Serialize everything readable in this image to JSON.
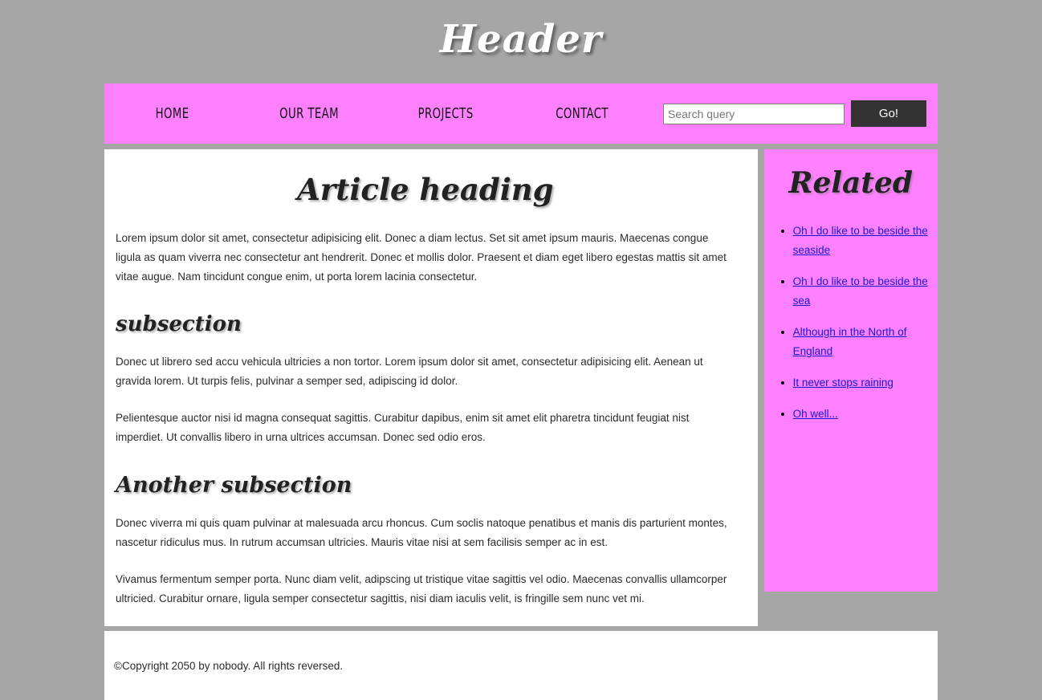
{
  "site": {
    "title": "Header",
    "background_color": "#a6a6a6",
    "accent_color": "#ff80ff",
    "button_color": "#333333",
    "link_color": "#1b1bcc"
  },
  "nav": {
    "items": [
      {
        "label": "HOME"
      },
      {
        "label": "OUR TEAM"
      },
      {
        "label": "PROJECTS"
      },
      {
        "label": "CONTACT"
      }
    ],
    "search": {
      "placeholder": "Search query",
      "value": "",
      "button_label": "Go!"
    }
  },
  "article": {
    "title": "Article heading",
    "intro": "Lorem ipsum dolor sit amet, consectetur adipisicing elit. Donec a diam lectus. Set sit amet ipsum mauris. Maecenas congue ligula as quam viverra nec consectetur ant hendrerit. Donec et mollis dolor. Praesent et diam eget libero egestas mattis sit amet vitae augue. Nam tincidunt congue enim, ut porta lorem lacinia consectetur.",
    "sections": [
      {
        "heading": "subsection",
        "paragraphs": [
          "Donec ut librero sed accu vehicula ultricies a non tortor. Lorem ipsum dolor sit amet, consectetur adipisicing elit. Aenean ut gravida lorem. Ut turpis felis, pulvinar a semper sed, adipiscing id dolor.",
          "Pelientesque auctor nisi id magna consequat sagittis. Curabitur dapibus, enim sit amet elit pharetra tincidunt feugiat nist imperdiet. Ut convallis libero in urna ultrices accumsan. Donec sed odio eros."
        ]
      },
      {
        "heading": "Another subsection",
        "paragraphs": [
          "Donec viverra mi quis quam pulvinar at malesuada arcu rhoncus. Cum soclis natoque penatibus et manis dis parturient montes, nascetur ridiculus mus. In rutrum accumsan ultricies. Mauris vitae nisi at sem facilisis semper ac in est.",
          "Vivamus fermentum semper porta. Nunc diam velit, adipscing ut tristique vitae sagittis vel odio. Maecenas convallis ullamcorper ultricied. Curabitur ornare, ligula semper consectetur sagittis, nisi diam iaculis velit, is fringille sem nunc vet mi."
        ]
      }
    ]
  },
  "sidebar": {
    "title": "Related",
    "links": [
      {
        "label": "Oh I do like to be beside the seaside"
      },
      {
        "label": "Oh I do like to be beside the sea"
      },
      {
        "label": "Although in the North of England"
      },
      {
        "label": "It never stops raining"
      },
      {
        "label": "Oh well..."
      }
    ]
  },
  "footer": {
    "copyright": "©Copyright 2050 by nobody. All rights reversed."
  }
}
